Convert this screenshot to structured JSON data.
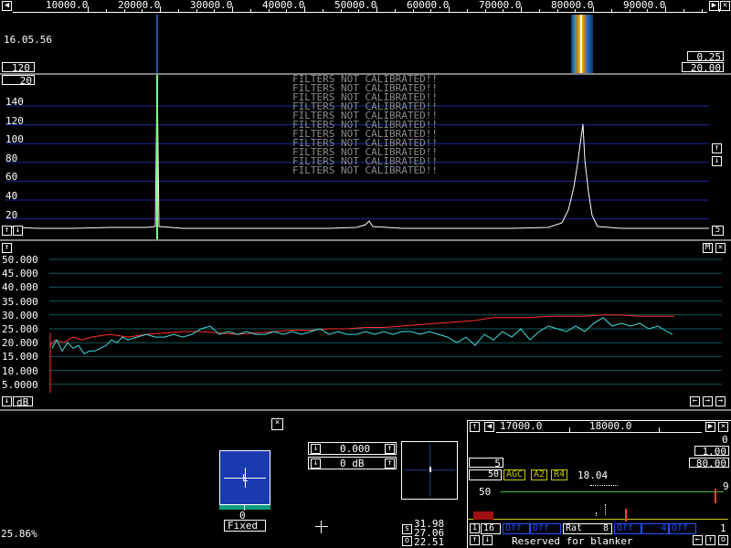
{
  "colors": {
    "background": "#000000",
    "grid_blue": "#1a2a9a",
    "grid_teal": "#0f5a5a",
    "spectrum_trace": "#ffffff",
    "carrier_green": "#80ff80",
    "noise_red": "#ff3030",
    "noise_cyan": "#40e0e0",
    "filter_text": "#8a8a8a",
    "blue_state": "#2050ff",
    "yellow_state": "#c8c800"
  },
  "top_scale": {
    "ticks": [
      "10000.0",
      "20000.0",
      "30000.0",
      "40000.0",
      "50000.0",
      "60000.0",
      "70000.0",
      "80000.0",
      "90000.0"
    ]
  },
  "waterfall": {
    "time": "16.05.56",
    "left_value": "120",
    "right_top_value": "0.25",
    "right_bottom_value": "20.00"
  },
  "spectrum": {
    "top_left_value": "20",
    "y_ticks": [
      "140",
      "120",
      "100",
      "80",
      "60",
      "40",
      "20"
    ],
    "warning": "FILTERS NOT CALIBRATED!!",
    "warning_repeat": 11,
    "right_value": "5",
    "trace_points": [
      [
        2,
        248
      ],
      [
        40,
        250
      ],
      [
        80,
        250
      ],
      [
        120,
        249
      ],
      [
        160,
        249
      ],
      [
        170,
        248
      ],
      [
        172,
        80
      ],
      [
        174,
        248
      ],
      [
        200,
        250
      ],
      [
        240,
        250
      ],
      [
        280,
        250
      ],
      [
        320,
        250
      ],
      [
        360,
        250
      ],
      [
        390,
        249
      ],
      [
        400,
        246
      ],
      [
        404,
        242
      ],
      [
        408,
        248
      ],
      [
        440,
        250
      ],
      [
        480,
        250
      ],
      [
        520,
        250
      ],
      [
        560,
        250
      ],
      [
        600,
        249
      ],
      [
        615,
        244
      ],
      [
        622,
        230
      ],
      [
        628,
        205
      ],
      [
        632,
        180
      ],
      [
        636,
        150
      ],
      [
        638,
        136
      ],
      [
        640,
        175
      ],
      [
        644,
        210
      ],
      [
        648,
        236
      ],
      [
        654,
        248
      ],
      [
        680,
        250
      ],
      [
        720,
        250
      ],
      [
        760,
        250
      ],
      [
        776,
        250
      ]
    ]
  },
  "noise_graph": {
    "right_label": "M",
    "y_ticks": [
      "50.000",
      "45.000",
      "40.000",
      "35.000",
      "30.000",
      "25.000",
      "20.000",
      "15.000",
      "10.000",
      "5.0000"
    ],
    "unit_label": "dB",
    "ylim": [
      0,
      50
    ],
    "red_series": [
      [
        55,
        19
      ],
      [
        60,
        21
      ],
      [
        70,
        20
      ],
      [
        80,
        22
      ],
      [
        90,
        21
      ],
      [
        100,
        22
      ],
      [
        120,
        23
      ],
      [
        140,
        22
      ],
      [
        160,
        23
      ],
      [
        180,
        23.5
      ],
      [
        200,
        24
      ],
      [
        220,
        24
      ],
      [
        240,
        23.5
      ],
      [
        260,
        23
      ],
      [
        280,
        23.5
      ],
      [
        300,
        24
      ],
      [
        320,
        24.5
      ],
      [
        340,
        24.5
      ],
      [
        360,
        25
      ],
      [
        380,
        25
      ],
      [
        400,
        25.5
      ],
      [
        420,
        25.5
      ],
      [
        440,
        26
      ],
      [
        460,
        26.5
      ],
      [
        480,
        27
      ],
      [
        500,
        27.5
      ],
      [
        520,
        28
      ],
      [
        540,
        29
      ],
      [
        560,
        29
      ],
      [
        580,
        29
      ],
      [
        600,
        29.5
      ],
      [
        620,
        29.5
      ],
      [
        640,
        29.5
      ],
      [
        660,
        30
      ],
      [
        680,
        30
      ],
      [
        700,
        29.5
      ],
      [
        720,
        29.5
      ],
      [
        738,
        29.5
      ]
    ],
    "cyan_series": [
      [
        57,
        18
      ],
      [
        62,
        21
      ],
      [
        68,
        17
      ],
      [
        74,
        20
      ],
      [
        80,
        18
      ],
      [
        86,
        19
      ],
      [
        92,
        16
      ],
      [
        98,
        17
      ],
      [
        104,
        17
      ],
      [
        110,
        18
      ],
      [
        116,
        19
      ],
      [
        122,
        21
      ],
      [
        128,
        20
      ],
      [
        134,
        22
      ],
      [
        140,
        21
      ],
      [
        150,
        22
      ],
      [
        160,
        23
      ],
      [
        170,
        22
      ],
      [
        180,
        22
      ],
      [
        190,
        23
      ],
      [
        200,
        22
      ],
      [
        210,
        23
      ],
      [
        220,
        25
      ],
      [
        230,
        26
      ],
      [
        240,
        23
      ],
      [
        250,
        24
      ],
      [
        260,
        23
      ],
      [
        270,
        24
      ],
      [
        280,
        23
      ],
      [
        290,
        23
      ],
      [
        300,
        24
      ],
      [
        310,
        23
      ],
      [
        320,
        24
      ],
      [
        330,
        23
      ],
      [
        340,
        24
      ],
      [
        350,
        25
      ],
      [
        360,
        23
      ],
      [
        370,
        24
      ],
      [
        380,
        23
      ],
      [
        390,
        23
      ],
      [
        400,
        24
      ],
      [
        410,
        23
      ],
      [
        420,
        24
      ],
      [
        430,
        23
      ],
      [
        440,
        24
      ],
      [
        450,
        24
      ],
      [
        460,
        23
      ],
      [
        470,
        24
      ],
      [
        480,
        23
      ],
      [
        490,
        22
      ],
      [
        500,
        20
      ],
      [
        510,
        22
      ],
      [
        520,
        19
      ],
      [
        530,
        23
      ],
      [
        540,
        21
      ],
      [
        550,
        24
      ],
      [
        560,
        22
      ],
      [
        570,
        25
      ],
      [
        580,
        21
      ],
      [
        590,
        24
      ],
      [
        600,
        26
      ],
      [
        610,
        25
      ],
      [
        620,
        24
      ],
      [
        630,
        26
      ],
      [
        640,
        24
      ],
      [
        650,
        27
      ],
      [
        660,
        29
      ],
      [
        670,
        26
      ],
      [
        680,
        27
      ],
      [
        690,
        26
      ],
      [
        700,
        27
      ],
      [
        710,
        25
      ],
      [
        720,
        26
      ],
      [
        730,
        24
      ],
      [
        736,
        23
      ]
    ]
  },
  "s_meter": {
    "channel": "L",
    "value": "0",
    "mode": "Fixed"
  },
  "controls": {
    "level_value": "0.000",
    "db_value": "0 dB"
  },
  "readouts": {
    "percent": "25.86%",
    "s_label": "s",
    "o_label": "o",
    "value1": "31.98",
    "value2": "27.06",
    "value3": "22.51"
  },
  "baseband": {
    "scale_left": "17000.0",
    "scale_right": "18000.0",
    "right_values": [
      "0",
      "1.00",
      "80.00"
    ],
    "left_value": "5",
    "field_50": "50",
    "agc_label": "AGC",
    "a2_label": "A2",
    "r4_label": "R4",
    "frequency": "18.04",
    "graph_y_label": "50",
    "right_marker": "9",
    "bottom_number": "16",
    "off_label": "Off",
    "rat_label": "Rat",
    "rat_value": "8",
    "num_4": "4",
    "num_1": "1",
    "status": "Reserved for blanker"
  }
}
